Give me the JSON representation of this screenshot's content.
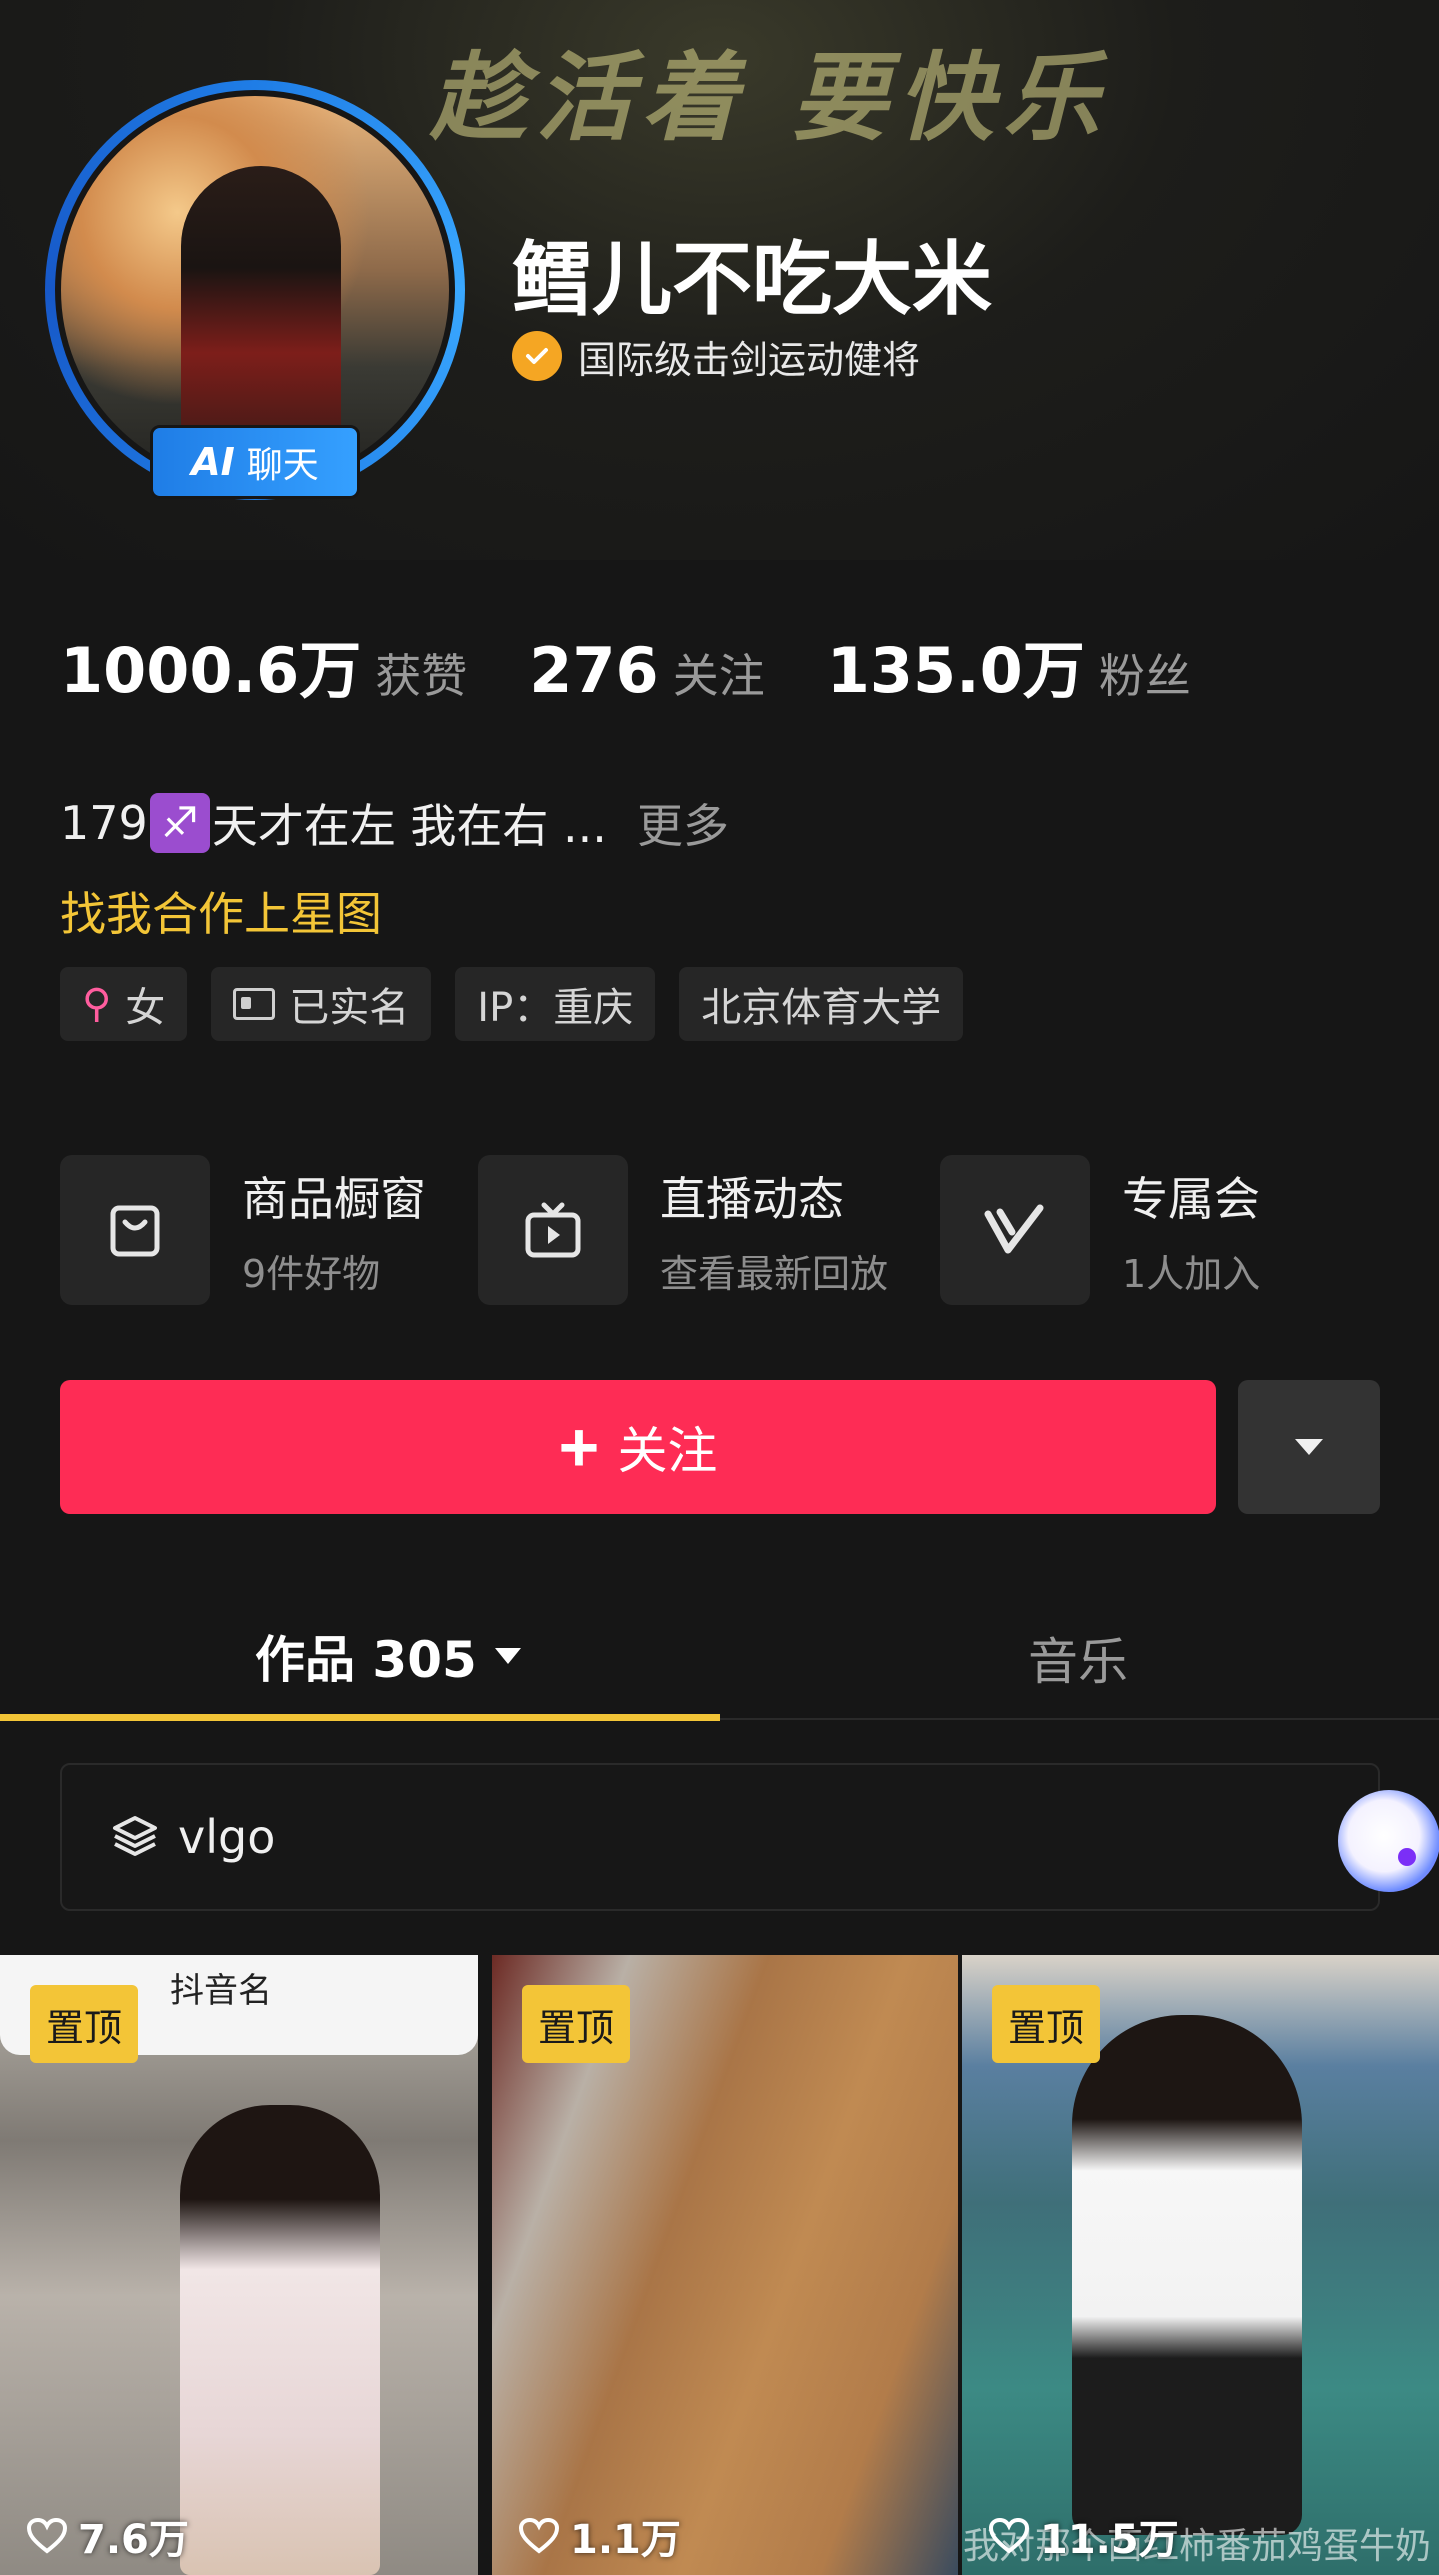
{
  "banner": {
    "text": "趁活着 要快乐"
  },
  "profile": {
    "name": "鳕儿不吃大米",
    "ai_badge": {
      "prefix": "AI",
      "label": "聊天"
    },
    "verification": "国际级击剑运动健将"
  },
  "stats": [
    {
      "value": "1000.6万",
      "label": "获赞"
    },
    {
      "value": "276",
      "label": "关注"
    },
    {
      "value": "135.0万",
      "label": "粉丝"
    }
  ],
  "bio": {
    "prefix": "179",
    "zodiac_glyph": "♐",
    "text": "天才在左 我在右 ...",
    "more": "更多",
    "star_link": "找我合作上星图"
  },
  "tags": [
    {
      "icon": "female-icon",
      "label": "女"
    },
    {
      "icon": "id-card-icon",
      "label": "已实名"
    },
    {
      "label": "IP：重庆"
    },
    {
      "label": "北京体育大学"
    }
  ],
  "features": [
    {
      "icon": "shopping-bag-icon",
      "title": "商品橱窗",
      "subtitle": "9件好物"
    },
    {
      "icon": "live-tv-icon",
      "title": "直播动态",
      "subtitle": "查看最新回放"
    },
    {
      "icon": "v-membership-icon",
      "title": "专属会",
      "subtitle": "1人加入"
    }
  ],
  "actions": {
    "follow": "关注"
  },
  "tabs": [
    {
      "label": "作品 305",
      "active": true
    },
    {
      "label": "音乐",
      "active": false
    }
  ],
  "collection": {
    "label": "vlgo"
  },
  "videos": [
    {
      "pinned": "置顶",
      "likes": "7.6万",
      "overlay_text": "抖音名"
    },
    {
      "pinned": "置顶",
      "likes": "1.1万"
    },
    {
      "pinned": "置顶",
      "likes": "11.5万",
      "caption": "我对那个西红柿番茄鸡蛋牛奶"
    }
  ],
  "colors": {
    "background": "#161616",
    "follow_button": "#fe2c55",
    "accent_yellow": "#f3c537",
    "ai_badge_blue": "#1f7de6",
    "verify_orange": "#f5a623"
  }
}
